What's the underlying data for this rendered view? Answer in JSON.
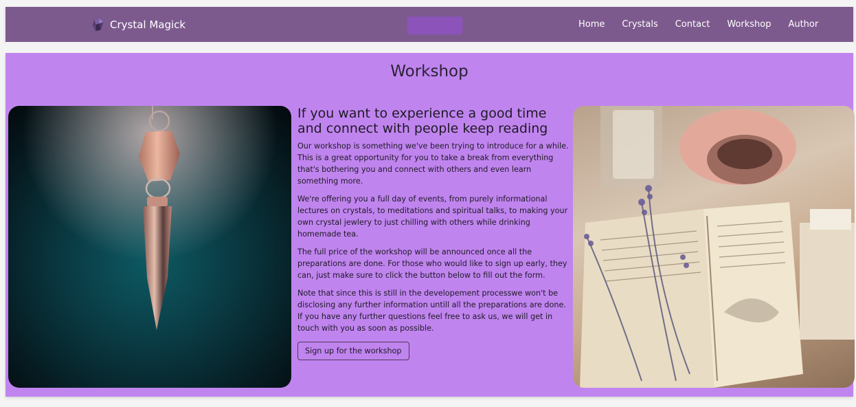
{
  "navbar": {
    "brand": "Crystal Magick",
    "links": [
      "Home",
      "Crystals",
      "Contact",
      "Workshop",
      "Author"
    ]
  },
  "main": {
    "title": "Workshop",
    "subtitle": "If you want to experience a good time and connect with people keep reading",
    "paragraphs": [
      "Our workshop is something we've been trying to introduce for a while. This is a great opportunity for you to take a break from everything that's bothering you and connect with others and even learn something more.",
      "We're offering you a full day of events, from purely informational lectures on crystals, to meditations and spiritual talks, to making your own crystal jewlery to just chilling with others while drinking homemade tea.",
      "The full price of the workshop will be announced once all the preparations are done. For those who would like to sign up early, they can, just make sure to click the button below to fill out the form.",
      "Note that since this is still in the developement processwe won't be disclosing any further information untill all the preparations are done. If you have any further questions feel free to ask us, we will get in touch with you as soon as possible."
    ],
    "signup_label": "Sign up for the workshop"
  },
  "colors": {
    "navbar": "#7d5a8e",
    "main": "#c084ef",
    "text": "#1f1a26"
  },
  "icons": {
    "brand": "crystal-icon"
  }
}
